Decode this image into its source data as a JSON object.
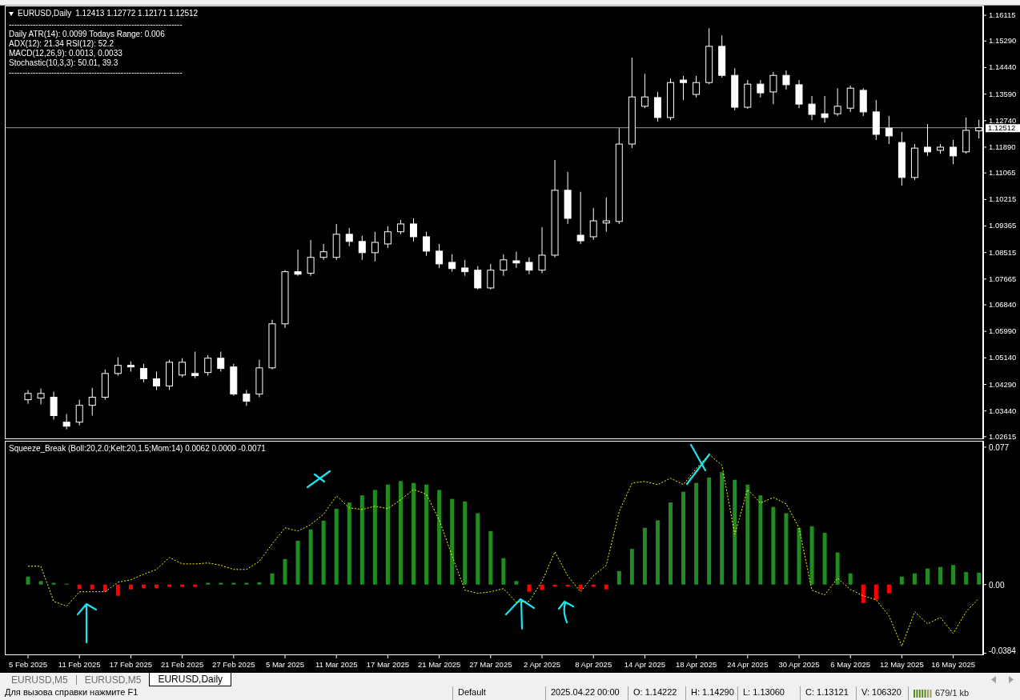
{
  "price_chart": {
    "symbol": "EURUSD,Daily",
    "ohlc": "1.12413 1.12772 1.12171 1.12512",
    "info_lines": [
      "-----------------------------------------------------------------",
      "Daily ATR(14): 0.0099 Todays Range: 0.006",
      "ADX(12): 21.34 RSI(12): 52.2",
      "MACD(12,26,9): 0.0013, 0.0033",
      "Stochastic(10,3,3): 50.01, 39.3",
      "-----------------------------------------------------------------"
    ],
    "chart_data": {
      "type": "candlestick",
      "ylim": [
        1.0256,
        1.164
      ],
      "yticks": [
        {
          "value": 1.16115,
          "label": "1.16115"
        },
        {
          "value": 1.1529,
          "label": "1.15290"
        },
        {
          "value": 1.1444,
          "label": "1.14440"
        },
        {
          "value": 1.1359,
          "label": "1.13590"
        },
        {
          "value": 1.1274,
          "label": "1.12740"
        },
        {
          "value": 1.1189,
          "label": "1.11890"
        },
        {
          "value": 1.11065,
          "label": "1.11065"
        },
        {
          "value": 1.10215,
          "label": "1.10215"
        },
        {
          "value": 1.09365,
          "label": "1.09365"
        },
        {
          "value": 1.08515,
          "label": "1.08515"
        },
        {
          "value": 1.07665,
          "label": "1.07665"
        },
        {
          "value": 1.0684,
          "label": "1.06840"
        },
        {
          "value": 1.0599,
          "label": "1.05990"
        },
        {
          "value": 1.0514,
          "label": "1.05140"
        },
        {
          "value": 1.0429,
          "label": "1.04290"
        },
        {
          "value": 1.0344,
          "label": "1.03440"
        },
        {
          "value": 1.02615,
          "label": "1.02615"
        }
      ],
      "ref_lines": [
        {
          "axis": "y",
          "value": 1.12512,
          "label": "1.12512",
          "color": "#9a9a9a"
        }
      ],
      "categories": [
        null,
        null,
        null,
        null,
        null,
        null,
        null,
        null,
        null,
        null,
        null,
        null,
        null,
        null,
        null,
        null,
        null,
        null,
        null,
        null,
        null,
        null,
        null,
        null,
        null,
        null,
        null,
        null,
        null,
        null,
        null,
        null,
        null,
        null,
        null,
        null,
        null,
        null,
        null,
        null,
        null,
        null,
        null,
        null,
        null,
        null,
        null,
        null,
        null,
        null,
        null,
        null,
        null,
        null,
        null,
        null,
        null,
        null,
        null,
        null,
        null,
        null,
        null,
        null,
        null,
        null,
        null,
        null,
        null,
        null,
        null,
        null,
        null,
        null,
        null
      ],
      "ohlc": [
        [
          1.038,
          1.0411,
          1.0367,
          1.04
        ],
        [
          1.0385,
          1.0416,
          1.0365,
          1.04
        ],
        [
          1.0388,
          1.0406,
          1.0316,
          1.0329
        ],
        [
          1.0308,
          1.0334,
          1.0285,
          1.0295
        ],
        [
          1.0308,
          1.038,
          1.0298,
          1.0362
        ],
        [
          1.0362,
          1.0418,
          1.0329,
          1.0388
        ],
        [
          1.0388,
          1.0477,
          1.038,
          1.0464
        ],
        [
          1.0464,
          1.0516,
          1.0457,
          1.049
        ],
        [
          1.049,
          1.0503,
          1.047,
          1.0485
        ],
        [
          1.048,
          1.0495,
          1.0436,
          1.0447
        ],
        [
          1.0447,
          1.047,
          1.0411,
          1.0424
        ],
        [
          1.0424,
          1.0508,
          1.0411,
          1.05
        ],
        [
          1.0459,
          1.0513,
          1.0452,
          1.05
        ],
        [
          1.0464,
          1.0534,
          1.0449,
          1.0457
        ],
        [
          1.0467,
          1.0523,
          1.0457,
          1.0513
        ],
        [
          1.0513,
          1.0534,
          1.047,
          1.048
        ],
        [
          1.0485,
          1.0495,
          1.0393,
          1.0398
        ],
        [
          1.0398,
          1.0411,
          1.036,
          1.0375
        ],
        [
          1.0398,
          1.0508,
          1.0388,
          1.0482
        ],
        [
          1.0482,
          1.0636,
          1.0477,
          1.0623
        ],
        [
          1.0623,
          1.0795,
          1.061,
          1.079
        ],
        [
          1.079,
          1.0861,
          1.0777,
          1.0782
        ],
        [
          1.0785,
          1.0892,
          1.0777,
          1.0836
        ],
        [
          1.0836,
          1.0879,
          1.0828,
          1.0854
        ],
        [
          1.0836,
          1.0943,
          1.0828,
          1.091
        ],
        [
          1.091,
          1.093,
          1.0872,
          1.0887
        ],
        [
          1.0887,
          1.0905,
          1.0828,
          1.0851
        ],
        [
          1.0851,
          1.0918,
          1.0823,
          1.0884
        ],
        [
          1.0879,
          1.0936,
          1.0866,
          1.0918
        ],
        [
          1.0918,
          1.0956,
          1.091,
          1.0943
        ],
        [
          1.0943,
          1.0961,
          1.0887,
          1.0902
        ],
        [
          1.0902,
          1.0918,
          1.0841,
          1.0856
        ],
        [
          1.0856,
          1.0879,
          1.0802,
          1.0815
        ],
        [
          1.082,
          1.0846,
          1.079,
          1.08
        ],
        [
          1.0802,
          1.0828,
          1.0777,
          1.079
        ],
        [
          1.0795,
          1.0808,
          1.0733,
          1.0738
        ],
        [
          1.0738,
          1.0815,
          1.0733,
          1.0795
        ],
        [
          1.0795,
          1.0846,
          1.0777,
          1.0828
        ],
        [
          1.0825,
          1.0854,
          1.0802,
          1.0818
        ],
        [
          1.082,
          1.0836,
          1.0782,
          1.0795
        ],
        [
          1.0795,
          1.0933,
          1.0785,
          1.0843
        ],
        [
          1.0843,
          1.1148,
          1.0836,
          1.1051
        ],
        [
          1.1051,
          1.111,
          1.0943,
          1.0961
        ],
        [
          1.0907,
          1.1046,
          1.0879,
          1.0889
        ],
        [
          1.0902,
          1.0994,
          1.0892,
          1.0953
        ],
        [
          1.0946,
          1.1028,
          1.0918,
          1.0953
        ],
        [
          1.0951,
          1.125,
          1.0943,
          1.1199
        ],
        [
          1.1199,
          1.1476,
          1.1186,
          1.135
        ],
        [
          1.132,
          1.1424,
          1.1314,
          1.135
        ],
        [
          1.1348,
          1.1366,
          1.1271,
          1.1284
        ],
        [
          1.1284,
          1.1409,
          1.1276,
          1.1396
        ],
        [
          1.1404,
          1.1417,
          1.134,
          1.1396
        ],
        [
          1.1358,
          1.1417,
          1.1348,
          1.1396
        ],
        [
          1.1396,
          1.157,
          1.1391,
          1.1512
        ],
        [
          1.1512,
          1.1547,
          1.1412,
          1.1419
        ],
        [
          1.1419,
          1.1442,
          1.1307,
          1.1317
        ],
        [
          1.1317,
          1.1404,
          1.1312,
          1.1391
        ],
        [
          1.1391,
          1.1404,
          1.1348,
          1.1363
        ],
        [
          1.1366,
          1.143,
          1.1327,
          1.1419
        ],
        [
          1.1419,
          1.1435,
          1.1373,
          1.1389
        ],
        [
          1.1389,
          1.1404,
          1.1314,
          1.1327
        ],
        [
          1.1327,
          1.1353,
          1.1276,
          1.1294
        ],
        [
          1.1296,
          1.1353,
          1.1268,
          1.1284
        ],
        [
          1.1296,
          1.1378,
          1.1289,
          1.132
        ],
        [
          1.1314,
          1.1386,
          1.1302,
          1.1378
        ],
        [
          1.1371,
          1.1378,
          1.1289,
          1.1302
        ],
        [
          1.1302,
          1.134,
          1.1212,
          1.123
        ],
        [
          1.125,
          1.1289,
          1.1199,
          1.1225
        ],
        [
          1.1204,
          1.1238,
          1.1066,
          1.1092
        ],
        [
          1.1092,
          1.1199,
          1.1084,
          1.1186
        ],
        [
          1.1189,
          1.1263,
          1.1161,
          1.1174
        ],
        [
          1.1179,
          1.1199,
          1.1168,
          1.1189
        ],
        [
          1.1189,
          1.1212,
          1.1135,
          1.1161
        ],
        [
          1.1174,
          1.1284,
          1.1168,
          1.1243
        ],
        [
          1.12413,
          1.12772,
          1.12171,
          1.12512
        ]
      ]
    }
  },
  "indicator_panel": {
    "title": "Squeeze_Break (Boll:20,2.0;Kelt:20,1.5;Mom:14) 0.0062 0.0000 -0.0071",
    "chart_data": {
      "type": "bar",
      "ylim": [
        -0.0391,
        0.0801
      ],
      "yticks": [
        {
          "value": 0.077,
          "label": "0.077"
        },
        {
          "value": 0,
          "label": "0.00"
        },
        {
          "value": -0.0384,
          "label": "-0.0384"
        }
      ],
      "categories": [
        "5 Feb 2025",
        null,
        null,
        null,
        "11 Feb 2025",
        null,
        null,
        null,
        "17 Feb 2025",
        null,
        null,
        null,
        "21 Feb 2025",
        null,
        null,
        null,
        "27 Feb 2025",
        null,
        null,
        null,
        "5 Mar 2025",
        null,
        null,
        null,
        "11 Mar 2025",
        null,
        null,
        null,
        "17 Mar 2025",
        null,
        null,
        null,
        "21 Mar 2025",
        null,
        null,
        null,
        "27 Mar 2025",
        null,
        null,
        null,
        "2 Apr 2025",
        null,
        null,
        null,
        "8 Apr 2025",
        null,
        null,
        null,
        "14 Apr 2025",
        null,
        null,
        null,
        "18 Apr 2025",
        null,
        null,
        null,
        "24 Apr 2025",
        null,
        null,
        null,
        "30 Apr 2025",
        null,
        null,
        null,
        "6 May 2025",
        null,
        null,
        null,
        "12 May 2025",
        null,
        null,
        null,
        "16 May 2025",
        null,
        null
      ],
      "series": [
        {
          "type": "bar",
          "color": "#228b22",
          "values": [
            0.0045,
            0.002,
            0.001,
            0.0005,
            null,
            null,
            null,
            null,
            null,
            null,
            null,
            null,
            null,
            null,
            0.001,
            0.001,
            0.001,
            0.001,
            0.0013,
            0.0063,
            0.0143,
            0.0246,
            0.0309,
            0.0358,
            0.0425,
            0.046,
            0.05,
            0.053,
            0.056,
            0.058,
            0.057,
            0.056,
            0.053,
            0.048,
            0.0466,
            0.04,
            0.03,
            0.0148,
            0.002,
            null,
            null,
            null,
            null,
            null,
            null,
            null,
            0.0076,
            0.02,
            0.0318,
            0.036,
            0.046,
            0.052,
            0.057,
            0.06,
            0.063,
            0.0587,
            0.056,
            0.05,
            0.0435,
            0.04,
            0.0318,
            0.0327,
            0.029,
            0.018,
            0.0063,
            null,
            null,
            null,
            0.0045,
            0.0063,
            0.009,
            0.0099,
            0.011,
            0.007,
            0.0067
          ]
        },
        {
          "type": "bar",
          "color": "#ff0000",
          "values": [
            null,
            null,
            null,
            null,
            -0.0025,
            -0.0027,
            -0.004,
            -0.0063,
            -0.0027,
            -0.002,
            -0.002,
            -0.0013,
            -0.0013,
            -0.0013,
            null,
            null,
            null,
            null,
            null,
            null,
            null,
            null,
            null,
            null,
            null,
            null,
            null,
            null,
            null,
            null,
            null,
            null,
            null,
            null,
            null,
            null,
            null,
            null,
            null,
            -0.004,
            -0.003,
            -0.001,
            -0.001,
            -0.0027,
            -0.0013,
            -0.0027,
            null,
            null,
            null,
            null,
            null,
            null,
            null,
            null,
            null,
            null,
            null,
            null,
            null,
            null,
            null,
            null,
            null,
            null,
            null,
            -0.0103,
            -0.0085,
            -0.0049,
            null,
            null,
            null,
            null,
            null,
            null,
            null
          ]
        },
        {
          "type": "line",
          "color": "#ffff00",
          "line_style": "dashed",
          "values": [
            0.0103,
            0.0103,
            -0.0094,
            -0.0121,
            -0.004,
            -0.004,
            -0.004,
            0.0013,
            0.0027,
            0.0058,
            0.0085,
            0.0152,
            0.0116,
            0.0116,
            0.0121,
            0.0108,
            0.0085,
            0.0085,
            0.013,
            0.0228,
            0.0318,
            0.03,
            0.0336,
            0.0394,
            0.0497,
            0.043,
            0.0421,
            0.0439,
            0.0426,
            0.0475,
            0.0533,
            0.0506,
            0.0363,
            0.0161,
            -0.0031,
            -0.0049,
            -0.004,
            -0.0022,
            -0.0099,
            -0.0094,
            0.0018,
            0.0184,
            0.0049,
            -0.004,
            0.0049,
            0.0108,
            0.0408,
            0.0569,
            0.0578,
            0.056,
            0.0596,
            0.056,
            0.065,
            0.073,
            0.0668,
            0.0282,
            0.0533,
            0.0457,
            0.0488,
            0.0452,
            0.0318,
            -0.0031,
            -0.0058,
            0.0036,
            -0.0027,
            -0.0063,
            -0.0085,
            -0.0175,
            -0.0345,
            -0.0152,
            -0.022,
            -0.0184,
            -0.0273,
            -0.0152,
            -0.0076
          ]
        }
      ]
    }
  },
  "tabs": [
    {
      "label": "EURUSD,M5",
      "selected": false
    },
    {
      "label": "EURUSD,M5",
      "selected": false
    },
    {
      "label": "EURUSD,Daily",
      "selected": true
    }
  ],
  "status_bar": [
    "Для вызова справки нажмите F1",
    "Default",
    "2025.04.22 00:00",
    "O: 1.14222",
    "H: 1.14290",
    "L: 1.13060",
    "C: 1.13121",
    "V: 106320",
    "679/1 kb"
  ]
}
